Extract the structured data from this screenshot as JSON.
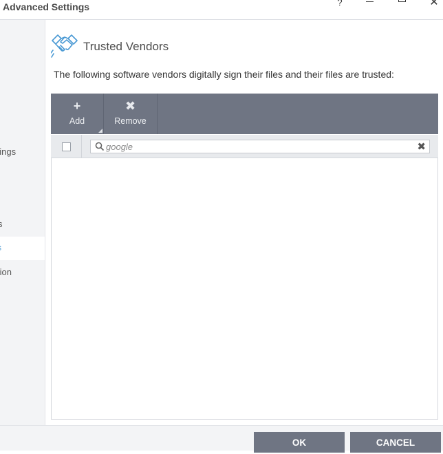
{
  "window": {
    "title": "Advanced Settings",
    "help_glyph": "?",
    "close_glyph": "✕"
  },
  "sidebar": {
    "items": [
      {
        "label": "ttings"
      },
      {
        "label": "s"
      },
      {
        "label": "rs",
        "selected": true
      },
      {
        "label": "tion"
      }
    ]
  },
  "page": {
    "title": "Trusted Vendors",
    "description": "The following software vendors digitally sign their files and their files are trusted:",
    "header_icon": "handshake-icon"
  },
  "toolbar": {
    "add_label": "Add",
    "add_icon": "plus-icon",
    "remove_label": "Remove",
    "remove_icon": "x-icon"
  },
  "filter": {
    "search_value": "google",
    "search_icon": "search-icon",
    "clear_icon": "clear-icon"
  },
  "vendors": [],
  "footer": {
    "ok_label": "OK",
    "cancel_label": "CANCEL"
  },
  "colors": {
    "toolbar": "#6f7583",
    "accent": "#5aa0d6",
    "sidebar_bg": "#f3f4f6"
  }
}
